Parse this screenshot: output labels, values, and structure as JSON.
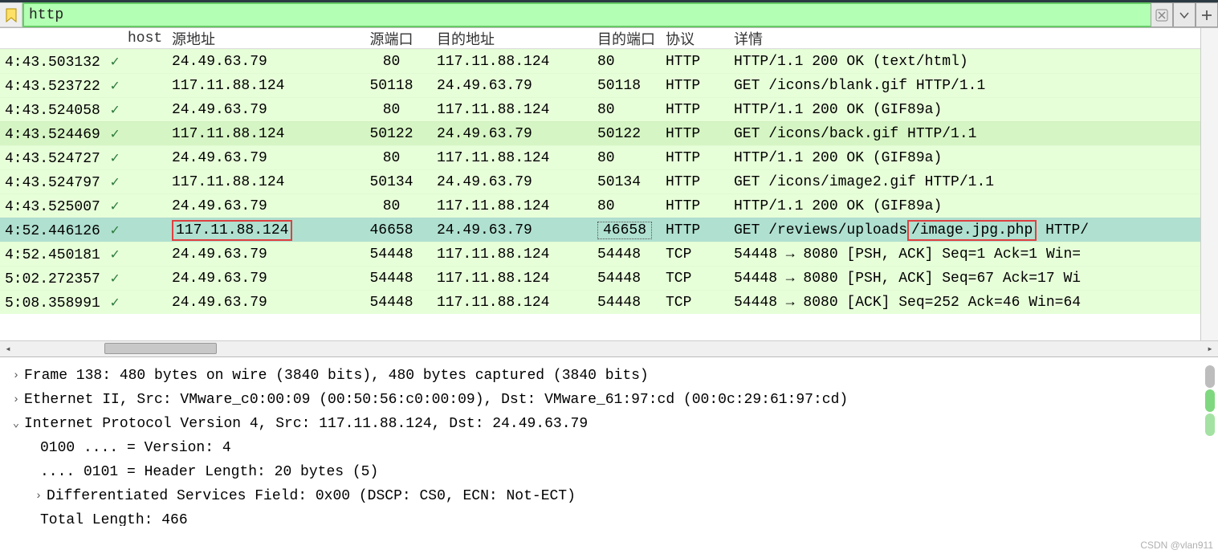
{
  "filter": {
    "value": "http"
  },
  "columns": {
    "time": "",
    "host": "host",
    "src": "源地址",
    "sport": "源端口",
    "dst": "目的地址",
    "dport": "目的端口",
    "proto": "协议",
    "info": "详情"
  },
  "rows": [
    {
      "cls": "light",
      "time": "4:43.503132",
      "host": "✓",
      "src": "24.49.63.79",
      "sport": "80",
      "dst": "117.11.88.124",
      "dport": "80",
      "proto": "HTTP",
      "info": "HTTP/1.1 200 OK  (text/html)"
    },
    {
      "cls": "light",
      "time": "4:43.523722",
      "host": "✓",
      "src": "117.11.88.124",
      "sport": "50118",
      "dst": "24.49.63.79",
      "dport": "50118",
      "proto": "HTTP",
      "info": "GET /icons/blank.gif HTTP/1.1"
    },
    {
      "cls": "light",
      "time": "4:43.524058",
      "host": "✓",
      "src": "24.49.63.79",
      "sport": "80",
      "dst": "117.11.88.124",
      "dport": "80",
      "proto": "HTTP",
      "info": "HTTP/1.1 200 OK  (GIF89a)"
    },
    {
      "cls": "lightalt",
      "time": "4:43.524469",
      "host": "✓",
      "src": "117.11.88.124",
      "sport": "50122",
      "dst": "24.49.63.79",
      "dport": "50122",
      "proto": "HTTP",
      "info": "GET /icons/back.gif HTTP/1.1"
    },
    {
      "cls": "light",
      "time": "4:43.524727",
      "host": "✓",
      "src": "24.49.63.79",
      "sport": "80",
      "dst": "117.11.88.124",
      "dport": "80",
      "proto": "HTTP",
      "info": "HTTP/1.1 200 OK  (GIF89a)"
    },
    {
      "cls": "light",
      "time": "4:43.524797",
      "host": "✓",
      "src": "117.11.88.124",
      "sport": "50134",
      "dst": "24.49.63.79",
      "dport": "50134",
      "proto": "HTTP",
      "info": "GET /icons/image2.gif HTTP/1.1"
    },
    {
      "cls": "light",
      "time": "4:43.525007",
      "host": "✓",
      "src": "24.49.63.79",
      "sport": "80",
      "dst": "117.11.88.124",
      "dport": "80",
      "proto": "HTTP",
      "info": "HTTP/1.1 200 OK  (GIF89a)"
    },
    {
      "cls": "sel",
      "time": "4:52.446126",
      "host": "✓",
      "src": "117.11.88.124",
      "sport": "46658",
      "dst": "24.49.63.79",
      "dport": "46658",
      "proto": "HTTP",
      "info_pre": "GET /reviews/uploads",
      "info_hi": "/image.jpg.php",
      "info_post": " HTTP/",
      "src_hi": true,
      "dport_box": true
    },
    {
      "cls": "light",
      "time": "4:52.450181",
      "host": "✓",
      "src": "24.49.63.79",
      "sport": "54448",
      "dst": "117.11.88.124",
      "dport": "54448",
      "proto": "TCP",
      "info": "54448 → 8080 [PSH, ACK] Seq=1 Ack=1 Win="
    },
    {
      "cls": "light",
      "time": "5:02.272357",
      "host": "✓",
      "src": "24.49.63.79",
      "sport": "54448",
      "dst": "117.11.88.124",
      "dport": "54448",
      "proto": "TCP",
      "info": "54448 → 8080 [PSH, ACK] Seq=67 Ack=17 Wi"
    },
    {
      "cls": "light",
      "time": "5:08.358991",
      "host": "✓",
      "src": "24.49.63.79",
      "sport": "54448",
      "dst": "117.11.88.124",
      "dport": "54448",
      "proto": "TCP",
      "info": "54448 → 8080 [ACK] Seq=252 Ack=46 Win=64"
    }
  ],
  "details": {
    "l0a": "Frame 138: 480 bytes on wire (3840 bits), 480 bytes captured (3840 bits)",
    "l0b": "Ethernet II, Src: VMware_c0:00:09 (00:50:56:c0:00:09), Dst: VMware_61:97:cd (00:0c:29:61:97:cd)",
    "l0c": "Internet Protocol Version 4, Src: 117.11.88.124, Dst: 24.49.63.79",
    "l1a": "0100 .... = Version: 4",
    "l1b": ".... 0101 = Header Length: 20 bytes (5)",
    "l1c": "Differentiated Services Field: 0x00 (DSCP: CS0, ECN: Not-ECT)",
    "l1d": "Total Length: 466"
  },
  "watermark": "CSDN @vlan911"
}
